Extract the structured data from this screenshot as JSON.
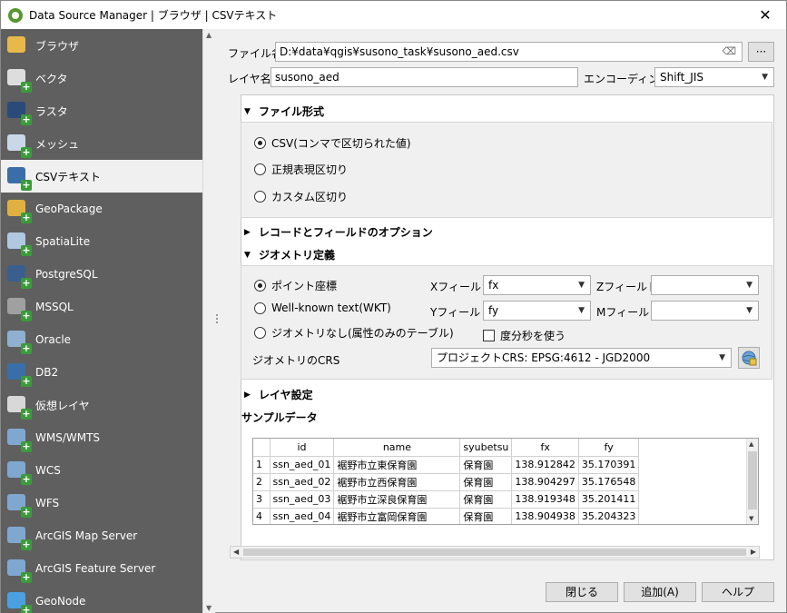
{
  "window": {
    "title": "Data Source Manager | ブラウザ | CSVテキスト",
    "close": "✕"
  },
  "sidebar": {
    "items": [
      {
        "label": "ブラウザ",
        "icon": "folder-icon"
      },
      {
        "label": "ベクタ",
        "icon": "vector-icon"
      },
      {
        "label": "ラスタ",
        "icon": "raster-icon"
      },
      {
        "label": "メッシュ",
        "icon": "mesh-icon"
      },
      {
        "label": "CSVテキスト",
        "icon": "csv-icon",
        "active": true
      },
      {
        "label": "GeoPackage",
        "icon": "geopackage-icon"
      },
      {
        "label": "SpatiaLite",
        "icon": "spatialite-icon"
      },
      {
        "label": "PostgreSQL",
        "icon": "postgresql-icon"
      },
      {
        "label": "MSSQL",
        "icon": "mssql-icon"
      },
      {
        "label": "Oracle",
        "icon": "oracle-icon"
      },
      {
        "label": "DB2",
        "icon": "db2-icon"
      },
      {
        "label": "仮想レイヤ",
        "icon": "virtual-layer-icon"
      },
      {
        "label": "WMS/WMTS",
        "icon": "wms-icon"
      },
      {
        "label": "WCS",
        "icon": "wcs-icon"
      },
      {
        "label": "WFS",
        "icon": "wfs-icon"
      },
      {
        "label": "ArcGIS Map Server",
        "icon": "arcgis-map-icon"
      },
      {
        "label": "ArcGIS Feature Server",
        "icon": "arcgis-feature-icon"
      },
      {
        "label": "GeoNode",
        "icon": "geonode-icon"
      }
    ]
  },
  "form": {
    "file_label": "ファイル名",
    "file_value": "D:¥data¥qgis¥susono_task¥susono_aed.csv",
    "browse_label": "···",
    "layer_label": "レイヤ名",
    "layer_value": "susono_aed",
    "encoding_label": "エンコーディング",
    "encoding_value": "Shift_JIS"
  },
  "file_format": {
    "header": "ファイル形式",
    "options": [
      "CSV(コンマで区切られた値)",
      "正規表現区切り",
      "カスタム区切り"
    ]
  },
  "records_header": "レコードとフィールドのオプション",
  "geometry": {
    "header": "ジオメトリ定義",
    "options": [
      "ポイント座標",
      "Well-known text(WKT)",
      "ジオメトリなし(属性のみのテーブル)"
    ],
    "x_label": "Xフィールド",
    "x_value": "fx",
    "y_label": "Yフィールド",
    "y_value": "fy",
    "z_label": "Zフィールド",
    "z_value": "",
    "m_label": "Mフィールド",
    "m_value": "",
    "dms_label": "度分秒を使う",
    "crs_label": "ジオメトリのCRS",
    "crs_value": "プロジェクトCRS: EPSG:4612 - JGD2000"
  },
  "layer_settings_header": "レイヤ設定",
  "sample": {
    "header": "サンプルデータ",
    "columns": [
      "id",
      "name",
      "syubetsu",
      "fx",
      "fy"
    ],
    "rows": [
      [
        "1",
        "ssn_aed_01",
        "裾野市立東保育園",
        "保育園",
        "138.912842",
        "35.170391"
      ],
      [
        "2",
        "ssn_aed_02",
        "裾野市立西保育園",
        "保育園",
        "138.904297",
        "35.176548"
      ],
      [
        "3",
        "ssn_aed_03",
        "裾野市立深良保育園",
        "保育園",
        "138.919348",
        "35.201411"
      ],
      [
        "4",
        "ssn_aed_04",
        "裾野市立富岡保育園",
        "保育園",
        "138.904938",
        "35.204323"
      ]
    ]
  },
  "buttons": {
    "close": "閉じる",
    "add": "追加(A)",
    "help": "ヘルプ"
  }
}
